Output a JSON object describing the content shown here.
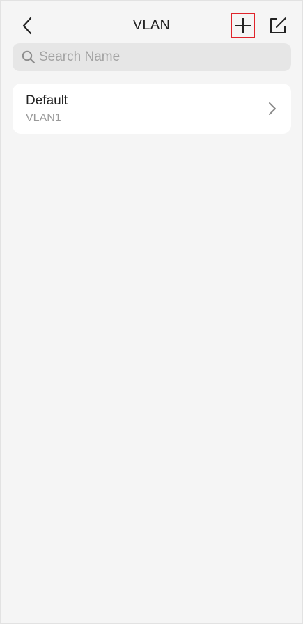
{
  "header": {
    "title": "VLAN",
    "back_icon": "chevron-left-icon",
    "add_icon": "plus-icon",
    "edit_icon": "edit-icon"
  },
  "search": {
    "placeholder": "Search Name",
    "value": "",
    "icon": "search-icon"
  },
  "vlans": [
    {
      "name": "Default",
      "id_label": "VLAN1",
      "icon": "chevron-right-icon"
    }
  ],
  "colors": {
    "background": "#f5f5f5",
    "card": "#ffffff",
    "search_field": "#e6e6e6",
    "highlight": "#e0242b"
  }
}
